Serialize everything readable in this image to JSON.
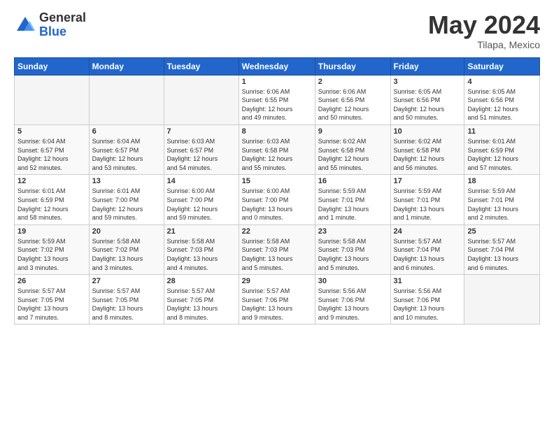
{
  "header": {
    "logo_general": "General",
    "logo_blue": "Blue",
    "month_title": "May 2024",
    "location": "Tilapa, Mexico"
  },
  "days_of_week": [
    "Sunday",
    "Monday",
    "Tuesday",
    "Wednesday",
    "Thursday",
    "Friday",
    "Saturday"
  ],
  "weeks": [
    [
      {
        "day": "",
        "info": ""
      },
      {
        "day": "",
        "info": ""
      },
      {
        "day": "",
        "info": ""
      },
      {
        "day": "1",
        "info": "Sunrise: 6:06 AM\nSunset: 6:55 PM\nDaylight: 12 hours\nand 49 minutes."
      },
      {
        "day": "2",
        "info": "Sunrise: 6:06 AM\nSunset: 6:56 PM\nDaylight: 12 hours\nand 50 minutes."
      },
      {
        "day": "3",
        "info": "Sunrise: 6:05 AM\nSunset: 6:56 PM\nDaylight: 12 hours\nand 50 minutes."
      },
      {
        "day": "4",
        "info": "Sunrise: 6:05 AM\nSunset: 6:56 PM\nDaylight: 12 hours\nand 51 minutes."
      }
    ],
    [
      {
        "day": "5",
        "info": "Sunrise: 6:04 AM\nSunset: 6:57 PM\nDaylight: 12 hours\nand 52 minutes."
      },
      {
        "day": "6",
        "info": "Sunrise: 6:04 AM\nSunset: 6:57 PM\nDaylight: 12 hours\nand 53 minutes."
      },
      {
        "day": "7",
        "info": "Sunrise: 6:03 AM\nSunset: 6:57 PM\nDaylight: 12 hours\nand 54 minutes."
      },
      {
        "day": "8",
        "info": "Sunrise: 6:03 AM\nSunset: 6:58 PM\nDaylight: 12 hours\nand 55 minutes."
      },
      {
        "day": "9",
        "info": "Sunrise: 6:02 AM\nSunset: 6:58 PM\nDaylight: 12 hours\nand 55 minutes."
      },
      {
        "day": "10",
        "info": "Sunrise: 6:02 AM\nSunset: 6:58 PM\nDaylight: 12 hours\nand 56 minutes."
      },
      {
        "day": "11",
        "info": "Sunrise: 6:01 AM\nSunset: 6:59 PM\nDaylight: 12 hours\nand 57 minutes."
      }
    ],
    [
      {
        "day": "12",
        "info": "Sunrise: 6:01 AM\nSunset: 6:59 PM\nDaylight: 12 hours\nand 58 minutes."
      },
      {
        "day": "13",
        "info": "Sunrise: 6:01 AM\nSunset: 7:00 PM\nDaylight: 12 hours\nand 59 minutes."
      },
      {
        "day": "14",
        "info": "Sunrise: 6:00 AM\nSunset: 7:00 PM\nDaylight: 12 hours\nand 59 minutes."
      },
      {
        "day": "15",
        "info": "Sunrise: 6:00 AM\nSunset: 7:00 PM\nDaylight: 13 hours\nand 0 minutes."
      },
      {
        "day": "16",
        "info": "Sunrise: 5:59 AM\nSunset: 7:01 PM\nDaylight: 13 hours\nand 1 minute."
      },
      {
        "day": "17",
        "info": "Sunrise: 5:59 AM\nSunset: 7:01 PM\nDaylight: 13 hours\nand 1 minute."
      },
      {
        "day": "18",
        "info": "Sunrise: 5:59 AM\nSunset: 7:01 PM\nDaylight: 13 hours\nand 2 minutes."
      }
    ],
    [
      {
        "day": "19",
        "info": "Sunrise: 5:59 AM\nSunset: 7:02 PM\nDaylight: 13 hours\nand 3 minutes."
      },
      {
        "day": "20",
        "info": "Sunrise: 5:58 AM\nSunset: 7:02 PM\nDaylight: 13 hours\nand 3 minutes."
      },
      {
        "day": "21",
        "info": "Sunrise: 5:58 AM\nSunset: 7:03 PM\nDaylight: 13 hours\nand 4 minutes."
      },
      {
        "day": "22",
        "info": "Sunrise: 5:58 AM\nSunset: 7:03 PM\nDaylight: 13 hours\nand 5 minutes."
      },
      {
        "day": "23",
        "info": "Sunrise: 5:58 AM\nSunset: 7:03 PM\nDaylight: 13 hours\nand 5 minutes."
      },
      {
        "day": "24",
        "info": "Sunrise: 5:57 AM\nSunset: 7:04 PM\nDaylight: 13 hours\nand 6 minutes."
      },
      {
        "day": "25",
        "info": "Sunrise: 5:57 AM\nSunset: 7:04 PM\nDaylight: 13 hours\nand 6 minutes."
      }
    ],
    [
      {
        "day": "26",
        "info": "Sunrise: 5:57 AM\nSunset: 7:05 PM\nDaylight: 13 hours\nand 7 minutes."
      },
      {
        "day": "27",
        "info": "Sunrise: 5:57 AM\nSunset: 7:05 PM\nDaylight: 13 hours\nand 8 minutes."
      },
      {
        "day": "28",
        "info": "Sunrise: 5:57 AM\nSunset: 7:05 PM\nDaylight: 13 hours\nand 8 minutes."
      },
      {
        "day": "29",
        "info": "Sunrise: 5:57 AM\nSunset: 7:06 PM\nDaylight: 13 hours\nand 9 minutes."
      },
      {
        "day": "30",
        "info": "Sunrise: 5:56 AM\nSunset: 7:06 PM\nDaylight: 13 hours\nand 9 minutes."
      },
      {
        "day": "31",
        "info": "Sunrise: 5:56 AM\nSunset: 7:06 PM\nDaylight: 13 hours\nand 10 minutes."
      },
      {
        "day": "",
        "info": ""
      }
    ]
  ]
}
